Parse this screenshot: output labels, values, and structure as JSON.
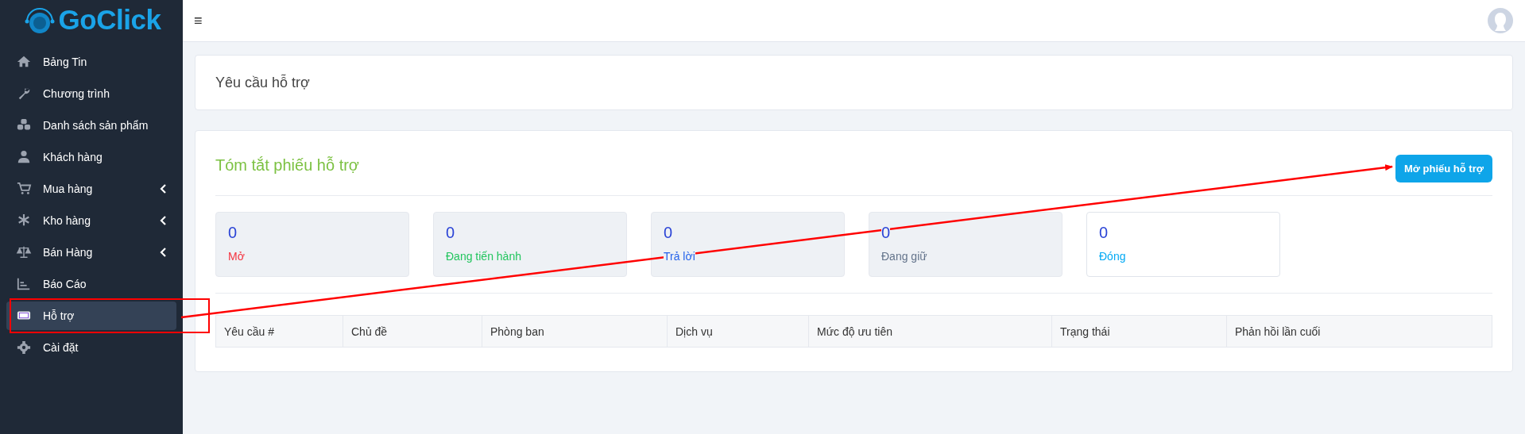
{
  "sidebar": {
    "logo": "GoClick",
    "items": [
      {
        "label": "Bảng Tin",
        "expandable": false,
        "selected": false
      },
      {
        "label": "Chương trình",
        "expandable": false,
        "selected": false
      },
      {
        "label": "Danh sách sản phẩm",
        "expandable": false,
        "selected": false
      },
      {
        "label": "Khách hàng",
        "expandable": false,
        "selected": false
      },
      {
        "label": "Mua hàng",
        "expandable": true,
        "selected": false
      },
      {
        "label": "Kho hàng",
        "expandable": true,
        "selected": false
      },
      {
        "label": "Bán Hàng",
        "expandable": true,
        "selected": false
      },
      {
        "label": "Báo Cáo",
        "expandable": false,
        "selected": false
      },
      {
        "label": "Hỗ trợ",
        "expandable": false,
        "selected": true
      },
      {
        "label": "Cài đặt",
        "expandable": false,
        "selected": false
      }
    ]
  },
  "topbar": {
    "menu_icon": "≡"
  },
  "page_title": "Yêu cầu hỗ trợ",
  "summary": {
    "title": "Tóm tắt phiếu hỗ trợ",
    "button": "Mở phiếu hỗ trợ",
    "stats": [
      {
        "count": "0",
        "label": "Mở",
        "color": "#f5333f",
        "highlighted": false
      },
      {
        "count": "0",
        "label": "Đang tiến hành",
        "color": "#22c55e",
        "highlighted": false
      },
      {
        "count": "0",
        "label": "Trả lời",
        "color": "#2563eb",
        "highlighted": false
      },
      {
        "count": "0",
        "label": "Đang giữ",
        "color": "#64748b",
        "highlighted": false
      },
      {
        "count": "0",
        "label": "Đóng",
        "color": "#03a9f4",
        "highlighted": true
      }
    ]
  },
  "table": {
    "columns": [
      "Yêu cầu #",
      "Chủ đề",
      "Phòng ban",
      "Dịch vụ",
      "Mức độ ưu tiên",
      "Trạng thái",
      "Phản hồi lần cuối"
    ]
  }
}
